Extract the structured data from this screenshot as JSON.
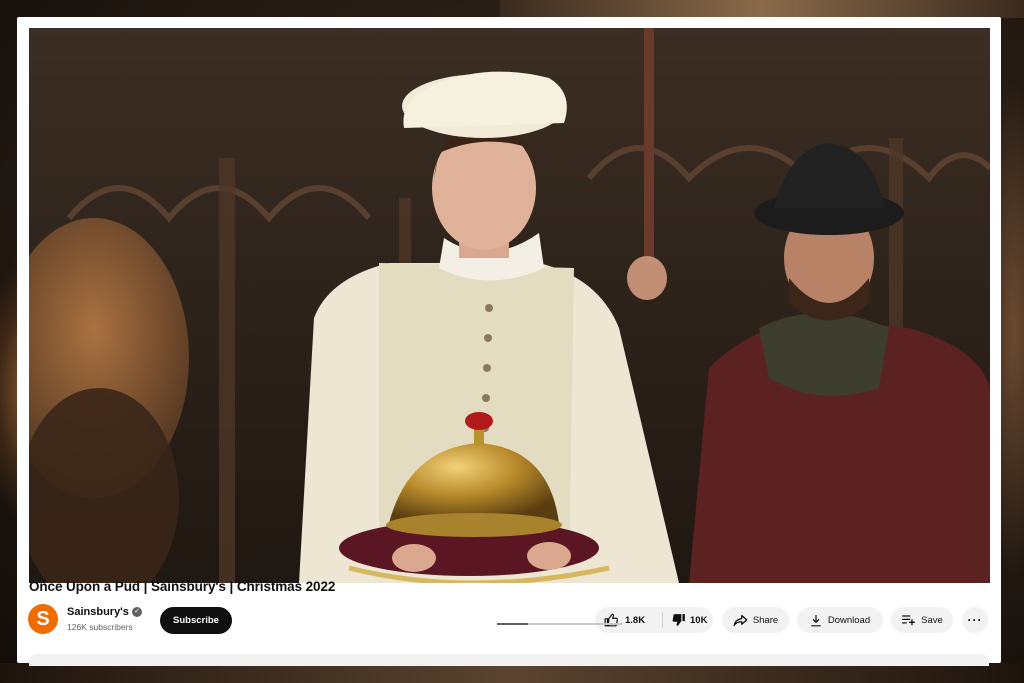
{
  "video": {
    "title": "Once Upon a Pud | Sainsbury's | Christmas 2022",
    "progress_fraction": 0.25
  },
  "channel": {
    "name": "Sainsbury's",
    "avatar_letter": "S",
    "subscribers": "126K subscribers",
    "verified_icon": "verified-check-icon",
    "subscribe_label": "Subscribe",
    "brand_color": "#f06c00"
  },
  "actions": {
    "like_count": "1.8K",
    "dislike_count": "10K",
    "share_label": "Share",
    "download_label": "Download",
    "save_label": "Save",
    "more_label": "···"
  }
}
